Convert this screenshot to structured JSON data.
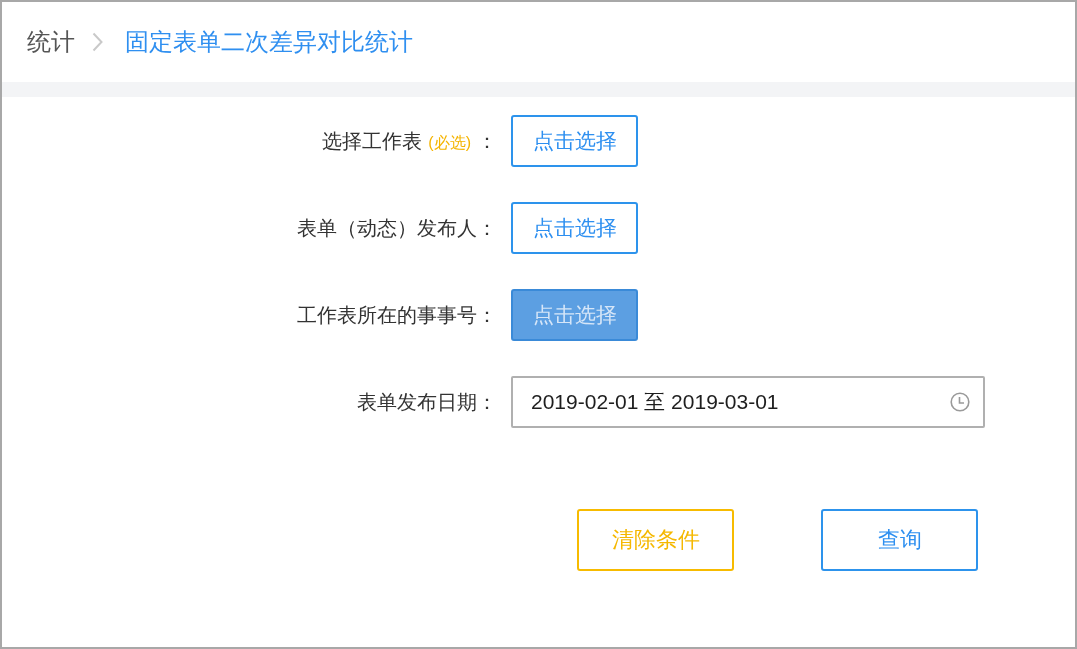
{
  "breadcrumb": {
    "items": [
      {
        "label": "统计",
        "current": false
      },
      {
        "label": "固定表单二次差异对比统计",
        "current": true
      }
    ]
  },
  "form": {
    "rows": [
      {
        "kind": "picker",
        "label": "选择工作表",
        "hint": "(必选)",
        "suffix": "：",
        "button": {
          "label": "点击选择",
          "active": false
        }
      },
      {
        "kind": "picker",
        "label": "表单（动态）发布人：",
        "button": {
          "label": "点击选择",
          "active": false
        }
      },
      {
        "kind": "picker",
        "label": "工作表所在的事事号：",
        "button": {
          "label": "点击选择",
          "active": true
        }
      },
      {
        "kind": "date_range",
        "label": "表单发布日期：",
        "value": "2019-02-01 至 2019-03-01"
      }
    ]
  },
  "actions": [
    {
      "kind": "clear",
      "label": "清除条件"
    },
    {
      "kind": "query",
      "label": "查询"
    }
  ]
}
